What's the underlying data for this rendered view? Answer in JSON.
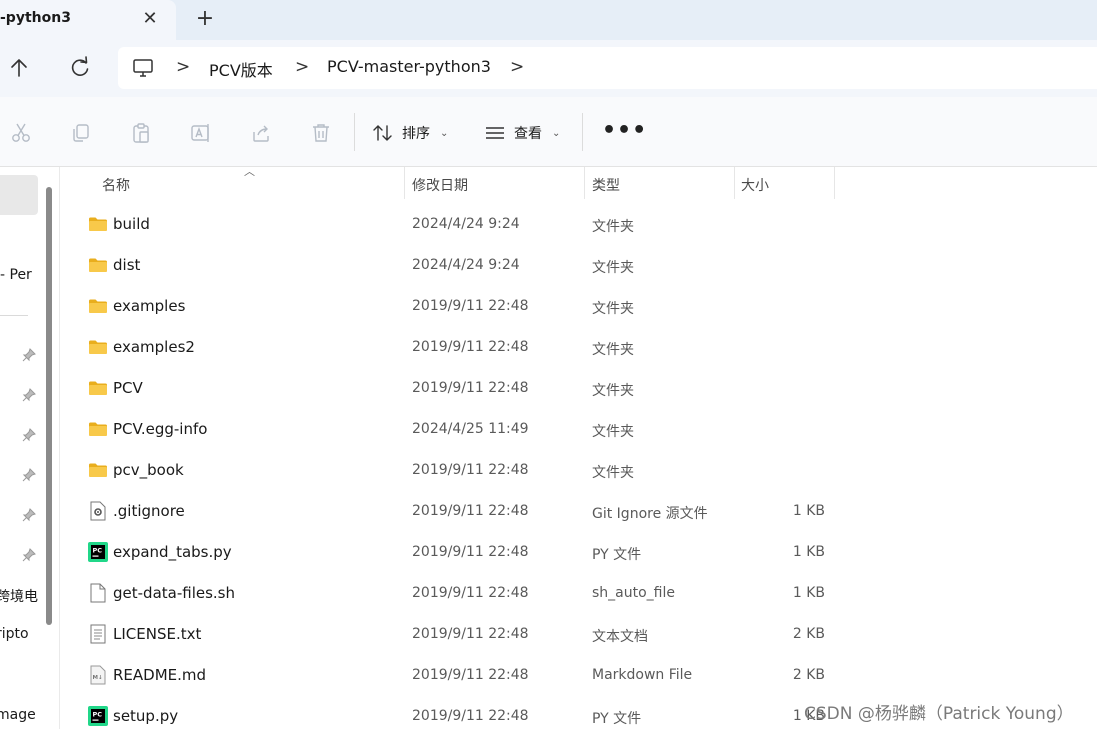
{
  "tab": {
    "title": "-python3",
    "close_glyph": "✕",
    "new_tab_glyph": "+"
  },
  "address": {
    "separator": ">",
    "crumbs": [
      "PCV版本",
      "PCV-master-python3"
    ]
  },
  "toolbar": {
    "icons": [
      "cut-icon",
      "copy-icon",
      "paste-icon",
      "rename-icon",
      "share-icon",
      "delete-icon"
    ],
    "sort_label": "排序",
    "view_label": "查看",
    "more_glyph": "•••"
  },
  "nav": {
    "partial_labels": [
      "- Per",
      "跨境电",
      "ripto",
      "mage"
    ]
  },
  "columns": {
    "name": "名称",
    "date": "修改日期",
    "type": "类型",
    "size": "大小"
  },
  "files": [
    {
      "name": "build",
      "date": "2024/4/24 9:24",
      "type": "文件夹",
      "size": "",
      "icon": "folder-icon"
    },
    {
      "name": "dist",
      "date": "2024/4/24 9:24",
      "type": "文件夹",
      "size": "",
      "icon": "folder-icon"
    },
    {
      "name": "examples",
      "date": "2019/9/11 22:48",
      "type": "文件夹",
      "size": "",
      "icon": "folder-icon"
    },
    {
      "name": "examples2",
      "date": "2019/9/11 22:48",
      "type": "文件夹",
      "size": "",
      "icon": "folder-icon"
    },
    {
      "name": "PCV",
      "date": "2019/9/11 22:48",
      "type": "文件夹",
      "size": "",
      "icon": "folder-icon"
    },
    {
      "name": "PCV.egg-info",
      "date": "2024/4/25 11:49",
      "type": "文件夹",
      "size": "",
      "icon": "folder-icon"
    },
    {
      "name": "pcv_book",
      "date": "2019/9/11 22:48",
      "type": "文件夹",
      "size": "",
      "icon": "folder-icon"
    },
    {
      "name": ".gitignore",
      "date": "2019/9/11 22:48",
      "type": "Git Ignore 源文件",
      "size": "1 KB",
      "icon": "gear-file-icon"
    },
    {
      "name": "expand_tabs.py",
      "date": "2019/9/11 22:48",
      "type": "PY 文件",
      "size": "1 KB",
      "icon": "pycharm-icon"
    },
    {
      "name": "get-data-files.sh",
      "date": "2019/9/11 22:48",
      "type": "sh_auto_file",
      "size": "1 KB",
      "icon": "blank-file-icon"
    },
    {
      "name": "LICENSE.txt",
      "date": "2019/9/11 22:48",
      "type": "文本文档",
      "size": "2 KB",
      "icon": "text-file-icon"
    },
    {
      "name": "README.md",
      "date": "2019/9/11 22:48",
      "type": "Markdown File",
      "size": "2 KB",
      "icon": "markdown-file-icon"
    },
    {
      "name": "setup.py",
      "date": "2019/9/11 22:48",
      "type": "PY 文件",
      "size": "1 KB",
      "icon": "pycharm-icon"
    }
  ],
  "watermark": "CSDN @杨骅麟（Patrick Young）",
  "colors": {
    "tabstrip": "#e6eef7",
    "addrrow": "#f3f6fb",
    "folder": "#f8c94a",
    "folder_dark": "#e9ae1d"
  }
}
